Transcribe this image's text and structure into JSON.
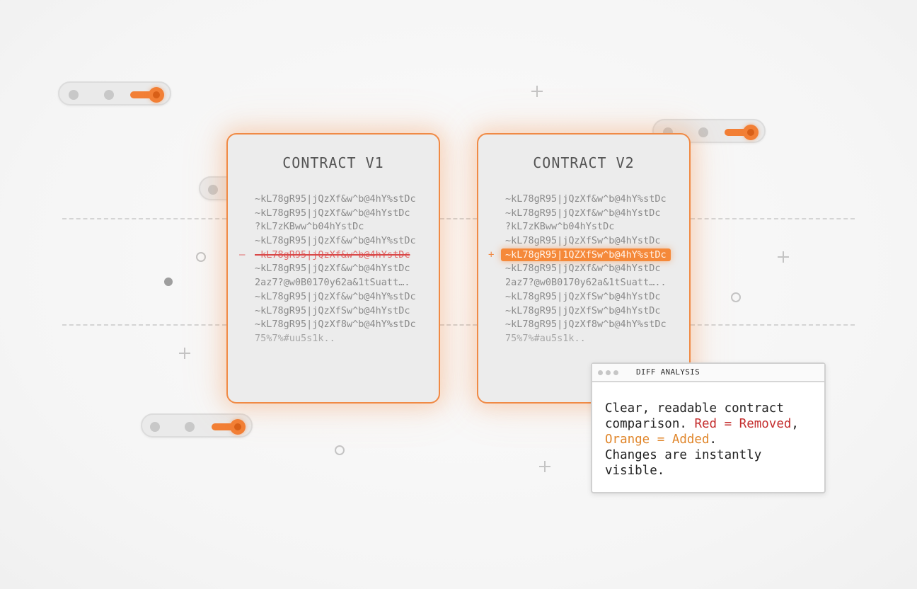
{
  "cards": [
    {
      "title": "CONTRACT V1",
      "lines": [
        {
          "text": "~kL78gR95|jQzXf&w^b@4hY%stDc",
          "kind": "normal"
        },
        {
          "text": "~kL78gR95|jQzXf&w^b@4hYstDc",
          "kind": "normal"
        },
        {
          "text": "?kL7zKBww^b04hYstDc",
          "kind": "normal"
        },
        {
          "text": "~kL78gR95|jQzXf&w^b@4hY%stDc",
          "kind": "normal"
        },
        {
          "text": "~kL78gR95|jQzXf&w^b@4hYstDc",
          "kind": "removed",
          "sign": "–"
        },
        {
          "text": "~kL78gR95|jQzXf&w^b@4hYstDc",
          "kind": "normal"
        },
        {
          "text": "2az7?@w0B0170y62a&1tSuatt….",
          "kind": "normal"
        },
        {
          "text": "~kL78gR95|jQzXf&w^b@4hY%stDc",
          "kind": "normal"
        },
        {
          "text": "~kL78gR95|jQzXfSw^b@4hYstDc",
          "kind": "normal"
        },
        {
          "text": "~kL78gR95|jQzXf8w^b@4hY%stDc",
          "kind": "normal"
        },
        {
          "text": "75%7%#uu5s1k..",
          "kind": "faint"
        }
      ]
    },
    {
      "title": "CONTRACT V2",
      "lines": [
        {
          "text": "~kL78gR95|jQzXf&w^b@4hY%stDc",
          "kind": "normal"
        },
        {
          "text": "~kL78gR95|jQzXf&w^b@4hYstDc",
          "kind": "normal"
        },
        {
          "text": "?kL7zKBww^b04hYstDc",
          "kind": "normal"
        },
        {
          "text": "~kL78gR95|jQzXfSw^b@4hYstDc",
          "kind": "normal"
        },
        {
          "text": "~kL78gR95|1QZXfSw^b@4hY%stDc",
          "kind": "added",
          "sign": "+"
        },
        {
          "text": "~kL78gR95|jQzXf&w^b@4hYstDc",
          "kind": "normal"
        },
        {
          "text": "2az7?@w0B0170y62a&1tSuatt…..",
          "kind": "normal"
        },
        {
          "text": "~kL78gR95|jQzXfSw^b@4hYstDc",
          "kind": "normal"
        },
        {
          "text": "~kL78gR95|jQzXfSw^b@4hYstDc",
          "kind": "normal"
        },
        {
          "text": "~kL78gR95|jQzXf8w^b@4hY%stDc",
          "kind": "normal"
        },
        {
          "text": "75%7%#au5s1k..",
          "kind": "faint"
        }
      ]
    }
  ],
  "panel": {
    "title": "DIFF ANALYSIS",
    "line1": "Clear, readable contract",
    "line2_a": "comparison. ",
    "line2_red": "Red = Removed",
    "line2_b": ",",
    "line3_orange": "Orange = Added",
    "line3_b": ".",
    "line4": "Changes are instantly",
    "line5": "visible."
  },
  "colors": {
    "accent": "#f27f35",
    "removed": "#c42d2d",
    "added": "#e0862b",
    "card_border": "#f08a45"
  },
  "icons": [
    "window-dots-icon",
    "toggle-slider-icon",
    "plus-icon",
    "ring-icon"
  ],
  "toggles": [
    {
      "state": "on"
    },
    {
      "state": "on"
    },
    {
      "state": "on"
    },
    {
      "state": "off"
    }
  ]
}
